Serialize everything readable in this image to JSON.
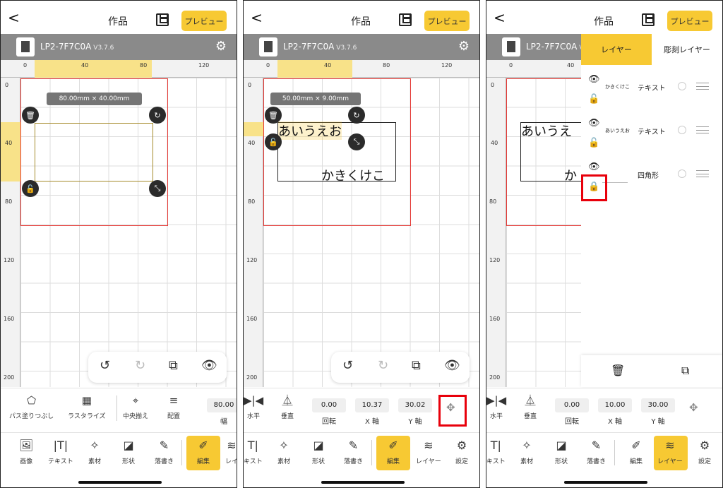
{
  "header": {
    "back": "<",
    "title": "作品",
    "preview_label": "プレビュー"
  },
  "device": {
    "name": "LP2-7F7C0A",
    "version": "V3.7.6"
  },
  "ruler": {
    "x_ticks": [
      "0",
      "40",
      "80",
      "120"
    ],
    "y_ticks": [
      "0",
      "40",
      "80",
      "120",
      "160",
      "200"
    ]
  },
  "icons": {
    "back": "chevron-left-icon",
    "save": "save-icon",
    "settings": "gear-icon",
    "delete": "trash-icon",
    "rotate": "rotate-icon",
    "unlock": "unlock-icon",
    "lock": "lock-icon",
    "resize": "resize-icon",
    "undo": "undo-icon",
    "redo": "redo-icon",
    "duplicate": "copy-icon",
    "visible": "eye-icon"
  },
  "colors": {
    "accent": "#f7c933",
    "highlight": "#e8000b",
    "workarea": "#e53935"
  },
  "panel1": {
    "dimension": "80.00mm × 40.00mm",
    "tools": [
      "パス塗りつぶし",
      "ラスタライズ",
      "中央揃え",
      "配置"
    ],
    "width_value": "80.00",
    "width_label": "幅",
    "nav": [
      "画像",
      "テキスト",
      "素材",
      "形状",
      "落書き",
      "編集",
      "レイ"
    ]
  },
  "panel2": {
    "dimension": "50.00mm × 9.00mm",
    "text1": "あいうえお",
    "text2": "かきくけこ",
    "tools": {
      "horizontal": "水平",
      "vertical": "垂直"
    },
    "fields": [
      {
        "value": "0.00",
        "label": "回転"
      },
      {
        "value": "10.37",
        "label": "X 軸"
      },
      {
        "value": "30.02",
        "label": "Y 軸"
      }
    ],
    "nav": [
      "キスト",
      "素材",
      "形状",
      "落書き",
      "編集",
      "レイヤー",
      "設定"
    ]
  },
  "panel3": {
    "canvas_text1": "あいうえ",
    "canvas_text2": "か",
    "tabs": {
      "layer": "レイヤー",
      "engrave_layer": "彫刻レイヤー"
    },
    "layers": [
      {
        "name": "かきくけこ",
        "type": "テキスト"
      },
      {
        "name": "あいうえお",
        "type": "テキスト"
      },
      {
        "name": "",
        "type": "四角形"
      }
    ],
    "tools": {
      "horizontal": "水平",
      "vertical": "垂直"
    },
    "fields": [
      {
        "value": "0.00",
        "label": "回転"
      },
      {
        "value": "10.00",
        "label": "X 軸"
      },
      {
        "value": "30.00",
        "label": "Y 軸"
      }
    ],
    "nav": [
      "キスト",
      "素材",
      "形状",
      "落書き",
      "編集",
      "レイヤー",
      "設定"
    ]
  }
}
